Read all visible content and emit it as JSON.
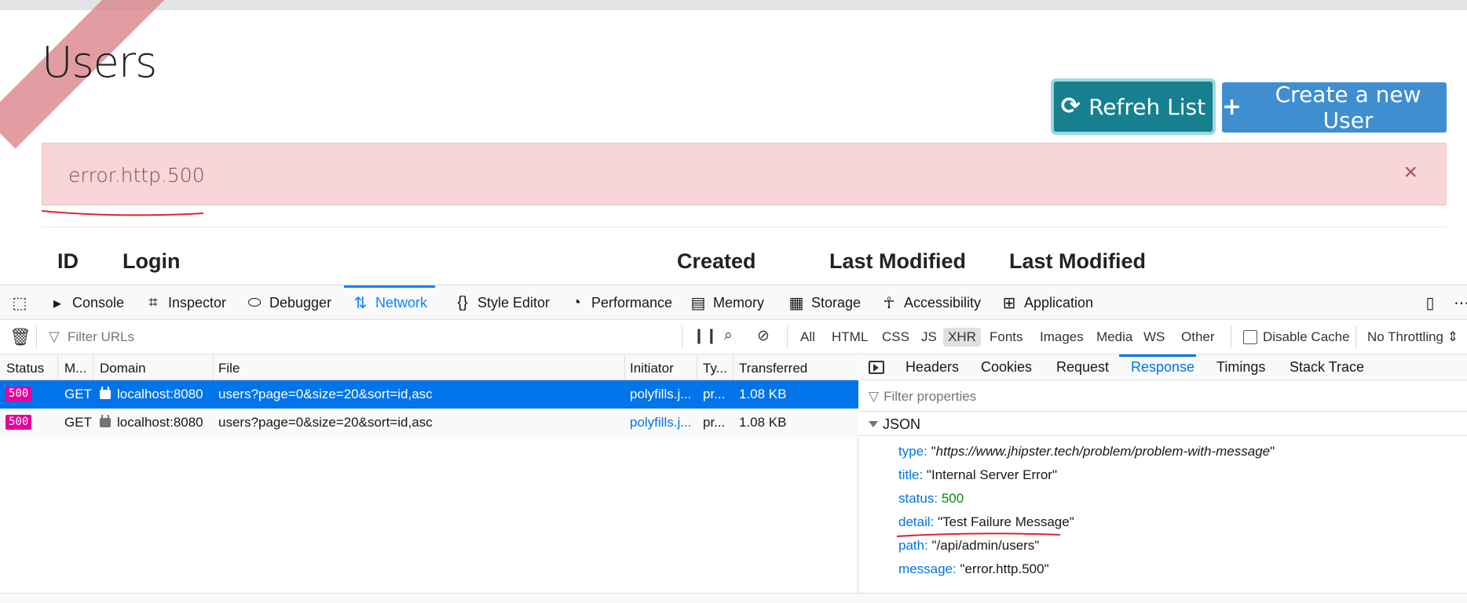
{
  "app": {
    "title": "Users",
    "refresh_label": "Refreh List",
    "refresh_icon": "refresh-icon",
    "create_label": "Create a new User",
    "create_icon": "plus-icon",
    "alert_text": "error.http.500",
    "alert_close": "×",
    "columns": [
      "ID",
      "Login",
      "Created",
      "Last Modified",
      "Last Modified"
    ],
    "alert_bg": "#f7d5d8",
    "refresh_bg": "#17808f",
    "create_bg": "#3e8ed0"
  },
  "devtools": {
    "tabs": [
      {
        "label": "Console",
        "icon": "console-icon"
      },
      {
        "label": "Inspector",
        "icon": "inspector-icon"
      },
      {
        "label": "Debugger",
        "icon": "debugger-icon"
      },
      {
        "label": "Network",
        "icon": "network-icon",
        "active": true
      },
      {
        "label": "Style Editor",
        "icon": "braces-icon"
      },
      {
        "label": "Performance",
        "icon": "gauge-icon"
      },
      {
        "label": "Memory",
        "icon": "memory-icon"
      },
      {
        "label": "Storage",
        "icon": "storage-icon"
      },
      {
        "label": "Accessibility",
        "icon": "accessibility-icon"
      },
      {
        "label": "Application",
        "icon": "grid-icon"
      }
    ],
    "filter_placeholder": "Filter URLs",
    "type_filters": [
      "All",
      "HTML",
      "CSS",
      "JS",
      "XHR",
      "Fonts",
      "Images",
      "Media",
      "WS",
      "Other"
    ],
    "selected_type": "XHR",
    "disable_cache": "Disable Cache",
    "throttling": "No Throttling",
    "request_columns": [
      "Status",
      "M...",
      "Domain",
      "File",
      "Initiator",
      "Ty...",
      "Transferred"
    ],
    "requests": [
      {
        "status": "500",
        "method": "GET",
        "domain": "localhost:8080",
        "file": "users?page=0&size=20&sort=id,asc",
        "initiator": "polyfills.j...",
        "type": "pr...",
        "transferred": "1.08 KB"
      },
      {
        "status": "500",
        "method": "GET",
        "domain": "localhost:8080",
        "file": "users?page=0&size=20&sort=id,asc",
        "initiator": "polyfills.j...",
        "type": "pr...",
        "transferred": "1.08 KB"
      }
    ],
    "detail_tabs": [
      "Headers",
      "Cookies",
      "Request",
      "Response",
      "Timings",
      "Stack Trace"
    ],
    "active_detail_tab": "Response",
    "prop_filter_placeholder": "Filter properties",
    "json_label": "JSON",
    "json": [
      {
        "key": "type:",
        "value": "https://www.jhipster.tech/problem/problem-with-message",
        "kind": "url"
      },
      {
        "key": "title:",
        "value": "\"Internal Server Error\"",
        "kind": "str"
      },
      {
        "key": "status:",
        "value": "500",
        "kind": "num"
      },
      {
        "key": "detail:",
        "value": "\"Test Failure Message\"",
        "kind": "str"
      },
      {
        "key": "path:",
        "value": "\"/api/admin/users\"",
        "kind": "str"
      },
      {
        "key": "message:",
        "value": "\"error.http.500\"",
        "kind": "str"
      }
    ],
    "accent": "#0a84ff",
    "error_badge": "#e5009a"
  }
}
